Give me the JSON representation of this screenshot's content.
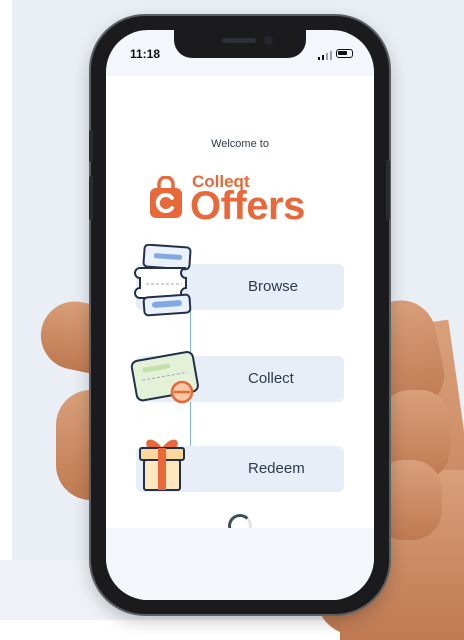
{
  "status_bar": {
    "time": "11:18"
  },
  "welcome_text": "Welcome to",
  "brand": {
    "small": "Colleqt",
    "large": "Offers"
  },
  "steps": [
    {
      "label": "Browse",
      "icon": "browse-tickets-icon"
    },
    {
      "label": "Collect",
      "icon": "collect-coupon-icon"
    },
    {
      "label": "Redeem",
      "icon": "gift-box-icon"
    }
  ],
  "loading": {
    "icon": "loading-spinner-icon"
  },
  "colors": {
    "brand": "#e8683a",
    "step_bg": "#e8eef7",
    "connector": "#7fb3d9"
  }
}
